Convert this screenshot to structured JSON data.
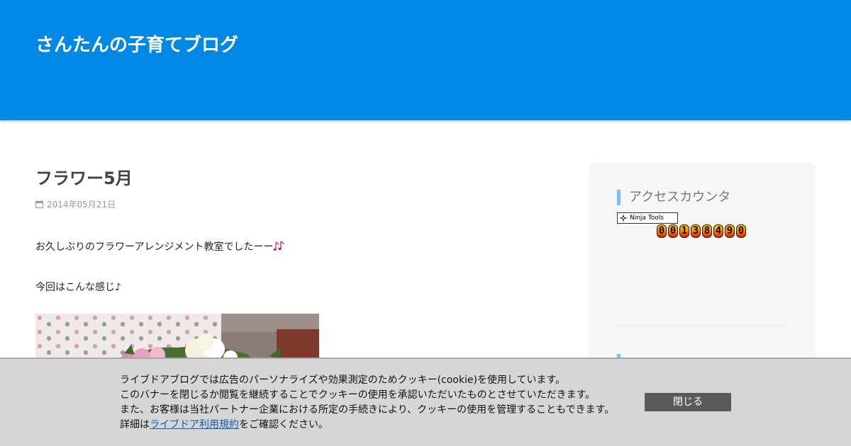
{
  "header": {
    "blog_title": "さんたんの子育てブログ",
    "background_color": "#0088e4"
  },
  "article": {
    "title": "フラワー5月",
    "date": "2014年05月21日",
    "date_icon": "calendar-icon",
    "paragraphs": [
      "お久しぶりのフラワーアレンジメント教室でしたーー",
      "今回はこんな感じ♪"
    ],
    "emoji_icon": "music-notes-icon"
  },
  "sidebar": {
    "widget_title": "アクセスカウンタ",
    "accent_color": "#78c2f0",
    "ninja_badge_label": "Ninja Tools",
    "counter_digits": [
      "0",
      "0",
      "1",
      "3",
      "8",
      "4",
      "9",
      "0"
    ]
  },
  "cookie_banner": {
    "line1": "ライブドアブログでは広告のパーソナライズや効果測定のためクッキー(cookie)を使用しています。",
    "line2": "このバナーを閉じるか閲覧を継続することでクッキーの使用を承認いただいたものとさせていただきます。",
    "line3": "また、お客様は当社パートナー企業における所定の手続きにより、クッキーの使用を管理することもできます。",
    "line4_prefix": "詳細は",
    "line4_link": "ライブドア利用規約",
    "line4_suffix": "をご確認ください。",
    "close_label": "閉じる",
    "link_color": "#1558b0"
  }
}
